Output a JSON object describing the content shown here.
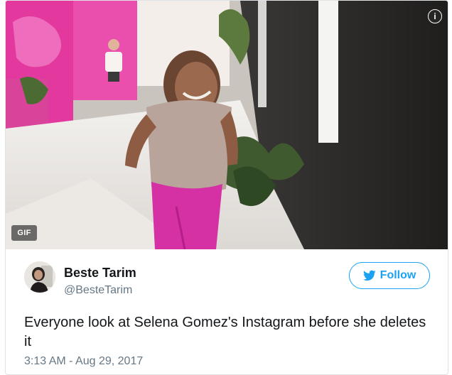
{
  "media": {
    "badge": "GIF",
    "info_icon": "info-icon",
    "colors": {
      "pink_wall": "#e83fa4",
      "pants": "#d931a6",
      "dark_wall": "#2c2a29"
    }
  },
  "author": {
    "name": "Beste Tarim",
    "handle": "@BesteTarim",
    "avatar_icon": "avatar"
  },
  "follow_button": {
    "label": "Follow",
    "icon": "bird-icon",
    "color": "#1da1f2"
  },
  "tweet": {
    "text": "Everyone look at Selena Gomez's Instagram before she deletes it",
    "timestamp": "3:13 AM - Aug 29, 2017"
  }
}
